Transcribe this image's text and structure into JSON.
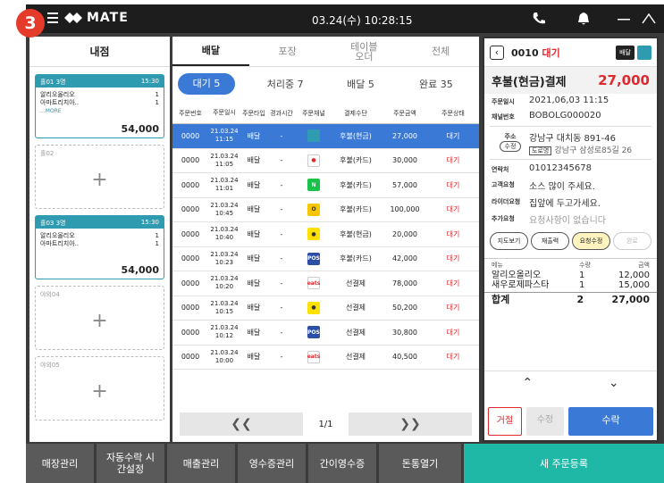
{
  "badge": "3",
  "brand": "MATE",
  "clock": "03.24(수) 10:28:15",
  "tables": {
    "title": "내점",
    "cards": [
      {
        "name": "홀01",
        "guests": "3명",
        "time": "15:30",
        "items": [
          {
            "n": "알리오올리오",
            "q": "1"
          },
          {
            "n": "아마트리치아..",
            "q": "1"
          }
        ],
        "more": "...MORE",
        "total": "54,000",
        "active": true
      },
      {
        "name": "홀02",
        "active": false
      },
      {
        "name": "홀03",
        "guests": "3명",
        "time": "15:30",
        "items": [
          {
            "n": "알리오올리오",
            "q": "1"
          },
          {
            "n": "아마트리치아..",
            "q": "1"
          }
        ],
        "total": "54,000",
        "active": true
      },
      {
        "name": "야외04",
        "active": false
      },
      {
        "name": "야외05",
        "active": false
      }
    ]
  },
  "orders": {
    "tabs": [
      "배달",
      "포장",
      "테이블 오더",
      "전체"
    ],
    "filters": [
      "대기 5",
      "처리중 7",
      "배달 5",
      "완료 35"
    ],
    "headers": [
      "주문번호",
      "주문일시",
      "주문타입",
      "경과시간",
      "주문채널",
      "결제수단",
      "주문금액",
      "주문상태"
    ],
    "rows": [
      {
        "no": "0000",
        "date": "21.03.24",
        "time": "11:15",
        "type": "배달",
        "elapsed": "-",
        "channel": "tablet",
        "pay": "후불(현금)",
        "amount": "27,000",
        "status": "대기"
      },
      {
        "no": "0000",
        "date": "21.03.24",
        "time": "11:05",
        "type": "배달",
        "elapsed": "-",
        "channel": "ddd",
        "pay": "후불(카드)",
        "amount": "30,000",
        "status": "대기"
      },
      {
        "no": "0000",
        "date": "21.03.24",
        "time": "11:01",
        "type": "배달",
        "elapsed": "-",
        "channel": "N",
        "pay": "후불(카드)",
        "amount": "57,000",
        "status": "대기"
      },
      {
        "no": "0000",
        "date": "21.03.24",
        "time": "10:45",
        "type": "배달",
        "elapsed": "-",
        "channel": "yogiyo",
        "pay": "후불(카드)",
        "amount": "100,000",
        "status": "대기"
      },
      {
        "no": "0000",
        "date": "21.03.24",
        "time": "10:40",
        "type": "배달",
        "elapsed": "-",
        "channel": "kakao",
        "pay": "후불(현금)",
        "amount": "20,000",
        "status": "대기"
      },
      {
        "no": "0000",
        "date": "21.03.24",
        "time": "10:23",
        "type": "배달",
        "elapsed": "-",
        "channel": "POS",
        "pay": "후불(카드)",
        "amount": "42,000",
        "status": "대기"
      },
      {
        "no": "0000",
        "date": "21.03.24",
        "time": "10:20",
        "type": "배달",
        "elapsed": "-",
        "channel": "eats",
        "pay": "선결제",
        "amount": "78,000",
        "status": "대기"
      },
      {
        "no": "0000",
        "date": "21.03.24",
        "time": "10:15",
        "type": "배달",
        "elapsed": "-",
        "channel": "kakao",
        "pay": "선결제",
        "amount": "50,200",
        "status": "대기"
      },
      {
        "no": "0000",
        "date": "21.03.24",
        "time": "10:12",
        "type": "배달",
        "elapsed": "-",
        "channel": "POS",
        "pay": "선결제",
        "amount": "30,800",
        "status": "대기"
      },
      {
        "no": "0000",
        "date": "21.03.24",
        "time": "10:00",
        "type": "배달",
        "elapsed": "-",
        "channel": "eats",
        "pay": "선결제",
        "amount": "40,500",
        "status": "대기"
      }
    ],
    "pager": {
      "prev": "❮❮",
      "page": "1/1",
      "next": "❯❯"
    }
  },
  "detail": {
    "order_no": "0010",
    "status": "대기",
    "type_badge": "배달",
    "pay_label": "후불(현금)결제",
    "amount": "27,000",
    "fields": [
      {
        "k": "주문일시",
        "v": "2021,06,03 11:15"
      },
      {
        "k": "채널번호",
        "v": "BOBOLG000020"
      }
    ],
    "address_label": "주소",
    "edit": "수정",
    "address": "강남구 대치동 891-46",
    "road_tag": "도로명",
    "road_address": "강남구 삼성로85길 26",
    "phone_label": "연락처",
    "phone": "01012345678",
    "req1_label": "고객요청",
    "req1": "소스 많이 주세요.",
    "req2_label": "라이더요청",
    "req2": "집앞에 두고가세요.",
    "req3_label": "추가요청",
    "req3": "요청사항이 없습니다",
    "buttons": [
      "지도보기",
      "재출력",
      "요청수정",
      "완료"
    ],
    "menu_headers": [
      "메뉴",
      "수량",
      "금액"
    ],
    "menu": [
      {
        "n": "알리오올리오",
        "q": "1",
        "p": "12,000"
      },
      {
        "n": "새우로제파스타",
        "q": "1",
        "p": "15,000"
      }
    ],
    "total_label": "합계",
    "total_q": "2",
    "total_p": "27,000",
    "up": "⌃",
    "down": "⌄",
    "reject": "거절",
    "modify": "수정",
    "accept": "수락"
  },
  "bottom": [
    "매장관리",
    "자동수락 시간설정",
    "매출관리",
    "영수증관리",
    "간이영수증",
    "돈통열기",
    "새 주문등록"
  ]
}
